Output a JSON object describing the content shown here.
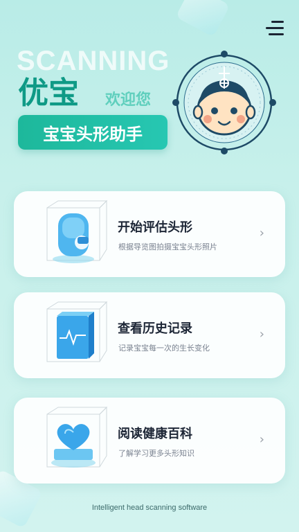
{
  "header": {
    "bg_word": "SCANNING",
    "brand": "优宝",
    "welcome": "欢迎您",
    "tagline": "宝宝头形助手",
    "menu_icon": "menu-icon"
  },
  "menu": [
    {
      "title": "开始评估头形",
      "subtitle": "根据导览图拍摄宝宝头形照片",
      "icon": "head-scan-icon"
    },
    {
      "title": "查看历史记录",
      "subtitle": "记录宝宝每一次的生长变化",
      "icon": "history-record-icon"
    },
    {
      "title": "阅读健康百科",
      "subtitle": "了解学习更多头形知识",
      "icon": "health-encyclopedia-icon"
    }
  ],
  "chevron": "›",
  "footer": "Intelligent head scanning software",
  "colors": {
    "accent": "#1db89b",
    "brand": "#0f9a86",
    "background": "#c7f0eb"
  }
}
